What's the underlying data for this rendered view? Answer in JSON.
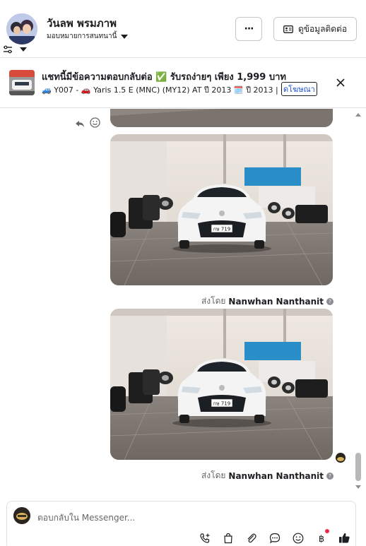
{
  "header": {
    "contact_name": "วันลพ พรมภาพ",
    "assign_label": "มอบหมายการสนทนานี้",
    "more_label": "···",
    "contact_info_label": "ดูข้อมูลติดต่อ"
  },
  "banner": {
    "title": "แชทนี้มีข้อความตอบกลับต่อ ✅ รับรถง่ายๆ เพียง 1,999 บาท",
    "subtitle": "🚙 Y007 - 🚗 Yaris 1.5 E (MNC) (MY12) AT ปี 2013 🗓️ ปี 2013 | ⚙️ เ...",
    "ad_tag": "ดโฆษณา"
  },
  "thread": {
    "sent_by_prefix": "ส่งโดย",
    "sender_name": "Nanwhan Nanthanit",
    "plate_text": "กษ 719"
  },
  "composer": {
    "placeholder": "ตอบกลับใน Messenger..."
  },
  "colors": {
    "accent": "#1b74e4",
    "border": "#dfe1e5",
    "muted_text": "#65676b",
    "notification_dot": "#f02849"
  }
}
